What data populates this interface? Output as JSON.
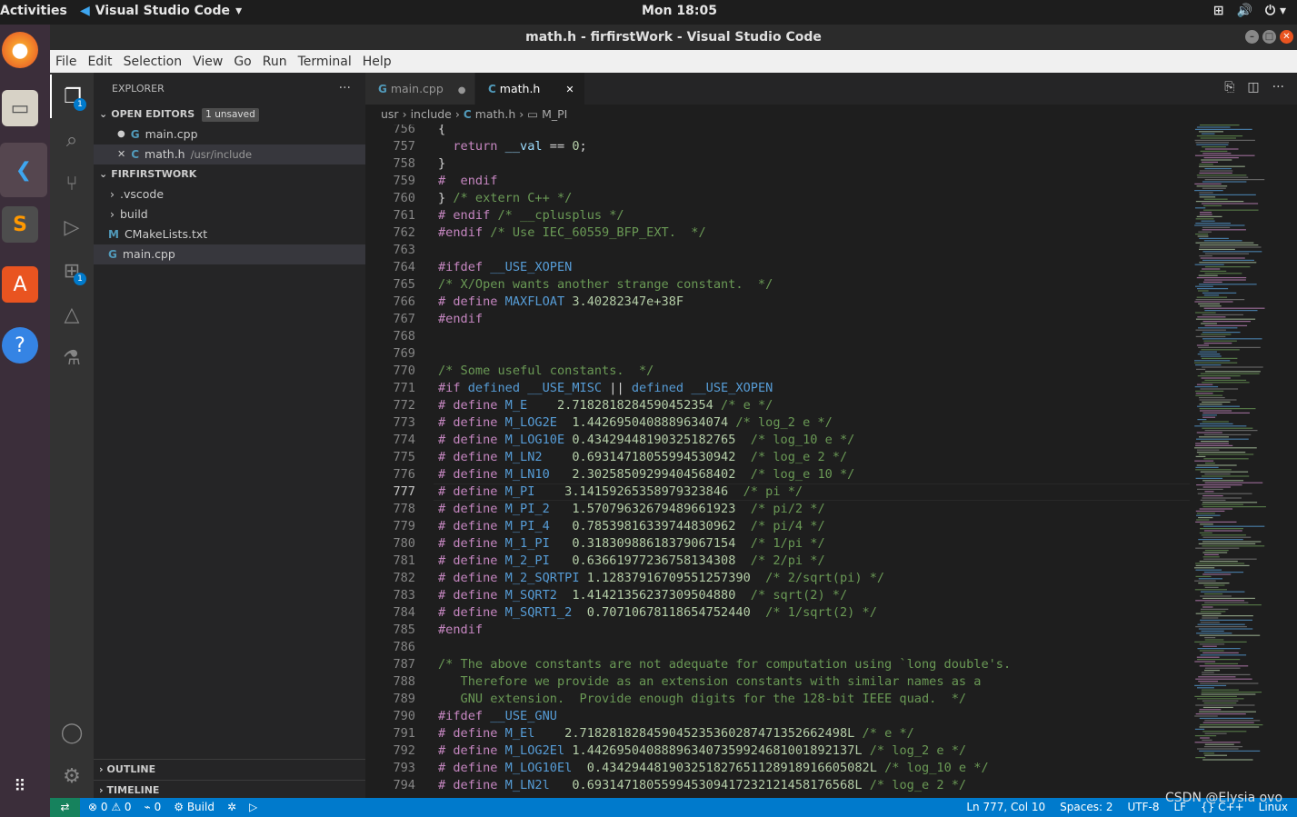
{
  "topbar": {
    "activities": "Activities",
    "app_name": "Visual Studio Code",
    "clock": "Mon 18:05"
  },
  "window": {
    "title": "math.h - firfirstWork - Visual Studio Code"
  },
  "menu": [
    "File",
    "Edit",
    "Selection",
    "View",
    "Go",
    "Run",
    "Terminal",
    "Help"
  ],
  "activity_bar": {
    "explorer_badge": "1",
    "extensions_badge": "1"
  },
  "sidebar": {
    "title": "EXPLORER",
    "more": "···",
    "open_editors": {
      "label": "OPEN EDITORS",
      "badge": "1 unsaved",
      "items": [
        {
          "name": "main.cpp",
          "desc": "",
          "marker": "●"
        },
        {
          "name": "math.h",
          "desc": "/usr/include",
          "marker": "✕"
        }
      ]
    },
    "workspace": {
      "label": "FIRFIRSTWORK",
      "items": [
        {
          "name": ".vscode",
          "type": "folder"
        },
        {
          "name": "build",
          "type": "folder"
        },
        {
          "name": "CMakeLists.txt",
          "type": "cmake"
        },
        {
          "name": "main.cpp",
          "type": "cpp"
        }
      ]
    },
    "outline": "OUTLINE",
    "timeline": "TIMELINE"
  },
  "tabs": [
    {
      "label": "main.cpp",
      "dirty": "●"
    },
    {
      "label": "math.h",
      "close": "✕"
    }
  ],
  "breadcrumb": [
    "usr",
    "include",
    "math.h",
    "M_PI"
  ],
  "editor": {
    "current_line": "777",
    "lines": [
      {
        "n": "756",
        "t": "{"
      },
      {
        "n": "757",
        "t": "  return __val == 0;"
      },
      {
        "n": "758",
        "t": "}"
      },
      {
        "n": "759",
        "t": "#  endif"
      },
      {
        "n": "760",
        "t": "} /* extern C++ */"
      },
      {
        "n": "761",
        "t": "# endif /* __cplusplus */"
      },
      {
        "n": "762",
        "t": "#endif /* Use IEC_60559_BFP_EXT.  */"
      },
      {
        "n": "763",
        "t": ""
      },
      {
        "n": "764",
        "t": "#ifdef __USE_XOPEN"
      },
      {
        "n": "765",
        "t": "/* X/Open wants another strange constant.  */"
      },
      {
        "n": "766",
        "t": "# define MAXFLOAT 3.40282347e+38F"
      },
      {
        "n": "767",
        "t": "#endif"
      },
      {
        "n": "768",
        "t": ""
      },
      {
        "n": "769",
        "t": ""
      },
      {
        "n": "770",
        "t": "/* Some useful constants.  */"
      },
      {
        "n": "771",
        "t": "#if defined __USE_MISC || defined __USE_XOPEN"
      },
      {
        "n": "772",
        "t": "# define M_E    2.7182818284590452354 /* e */"
      },
      {
        "n": "773",
        "t": "# define M_LOG2E  1.4426950408889634074 /* log_2 e */"
      },
      {
        "n": "774",
        "t": "# define M_LOG10E 0.43429448190325182765  /* log_10 e */"
      },
      {
        "n": "775",
        "t": "# define M_LN2    0.69314718055994530942  /* log_e 2 */"
      },
      {
        "n": "776",
        "t": "# define M_LN10   2.30258509299404568402  /* log_e 10 */"
      },
      {
        "n": "777",
        "t": "# define M_PI    3.14159265358979323846  /* pi */"
      },
      {
        "n": "778",
        "t": "# define M_PI_2   1.57079632679489661923  /* pi/2 */"
      },
      {
        "n": "779",
        "t": "# define M_PI_4   0.78539816339744830962  /* pi/4 */"
      },
      {
        "n": "780",
        "t": "# define M_1_PI   0.31830988618379067154  /* 1/pi */"
      },
      {
        "n": "781",
        "t": "# define M_2_PI   0.63661977236758134308  /* 2/pi */"
      },
      {
        "n": "782",
        "t": "# define M_2_SQRTPI 1.12837916709551257390  /* 2/sqrt(pi) */"
      },
      {
        "n": "783",
        "t": "# define M_SQRT2  1.41421356237309504880  /* sqrt(2) */"
      },
      {
        "n": "784",
        "t": "# define M_SQRT1_2  0.70710678118654752440  /* 1/sqrt(2) */"
      },
      {
        "n": "785",
        "t": "#endif"
      },
      {
        "n": "786",
        "t": ""
      },
      {
        "n": "787",
        "t": "/* The above constants are not adequate for computation using `long double's."
      },
      {
        "n": "788",
        "t": "   Therefore we provide as an extension constants with similar names as a"
      },
      {
        "n": "789",
        "t": "   GNU extension.  Provide enough digits for the 128-bit IEEE quad.  */"
      },
      {
        "n": "790",
        "t": "#ifdef __USE_GNU"
      },
      {
        "n": "791",
        "t": "# define M_El    2.718281828459045235360287471352662498L /* e */"
      },
      {
        "n": "792",
        "t": "# define M_LOG2El 1.442695040888963407359924681001892137L /* log_2 e */"
      },
      {
        "n": "793",
        "t": "# define M_LOG10El  0.434294481903251827651128918916605082L /* log_10 e */"
      },
      {
        "n": "794",
        "t": "# define M_LN2l   0.693147180559945309417232121458176568L /* log_e 2 */"
      }
    ]
  },
  "statusbar": {
    "errors": "⊗ 0 ⚠ 0",
    "ports": "0",
    "build": "Build",
    "position": "Ln 777, Col 10",
    "spaces": "Spaces: 2",
    "encoding": "UTF-8",
    "eol": "LF",
    "language": "C++",
    "os": "Linux"
  },
  "watermark": "CSDN @Elysia ovo",
  "colors": {
    "accent": "#007acc",
    "keyword": "#c586c0",
    "comment": "#6a9955",
    "number": "#b5cea8",
    "macro": "#569cd6",
    "text": "#d4d4d4"
  }
}
